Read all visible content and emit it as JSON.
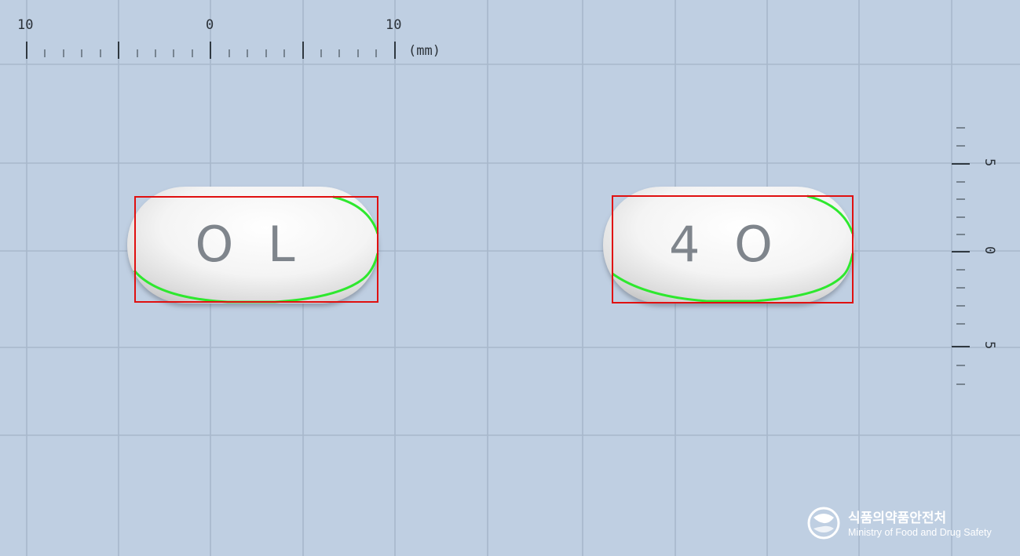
{
  "ruler_top": {
    "labels": [
      "10",
      "0",
      "10"
    ],
    "unit": "(mm)"
  },
  "ruler_right": {
    "labels": [
      "5",
      "0",
      "5"
    ]
  },
  "tablets": [
    {
      "imprint": "O L",
      "side": "front"
    },
    {
      "imprint": "4 O",
      "side": "back"
    }
  ],
  "watermark": {
    "korean": "식품의약품안전처",
    "english": "Ministry of Food and Drug Safety"
  },
  "colors": {
    "background": "#bfcfe2",
    "grid": "#a8b8cb",
    "bounding_box": "#e01010",
    "contour": "#2ee82e",
    "tablet": "#f2f2f2"
  }
}
